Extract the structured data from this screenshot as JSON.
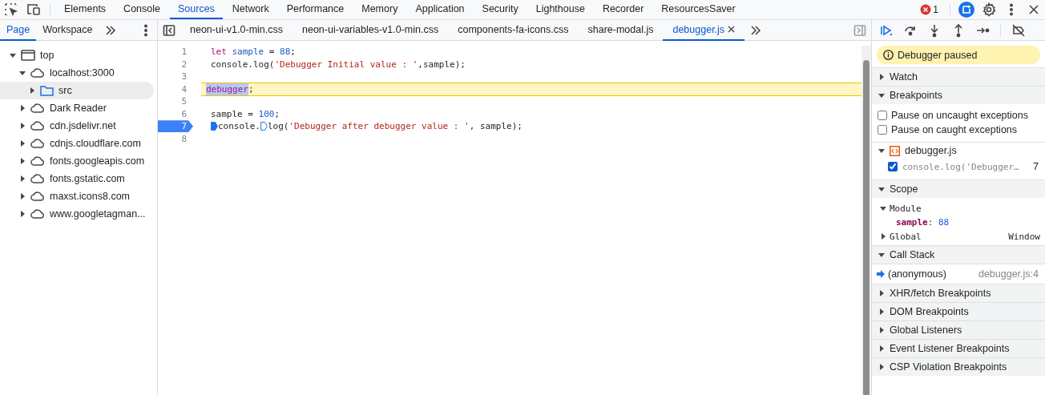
{
  "toolbar": {
    "error_count": "1"
  },
  "main_tabs": [
    {
      "label": "Elements",
      "selected": false
    },
    {
      "label": "Console",
      "selected": false
    },
    {
      "label": "Sources",
      "selected": true
    },
    {
      "label": "Network",
      "selected": false
    },
    {
      "label": "Performance",
      "selected": false
    },
    {
      "label": "Memory",
      "selected": false
    },
    {
      "label": "Application",
      "selected": false
    },
    {
      "label": "Security",
      "selected": false
    },
    {
      "label": "Lighthouse",
      "selected": false
    },
    {
      "label": "Recorder",
      "selected": false
    },
    {
      "label": "ResourcesSaver",
      "selected": false
    }
  ],
  "navigator": {
    "tabs": [
      {
        "label": "Page",
        "selected": true
      },
      {
        "label": "Workspace",
        "selected": false
      }
    ],
    "tree": [
      {
        "label": "top",
        "kind": "frame",
        "expanded": true,
        "selected": false,
        "children": [
          {
            "label": "localhost:3000",
            "kind": "origin",
            "expanded": true,
            "selected": false,
            "children": [
              {
                "label": "src",
                "kind": "folder",
                "expanded": false,
                "selected": true
              }
            ]
          },
          {
            "label": "Dark Reader",
            "kind": "origin",
            "expanded": false,
            "selected": false
          },
          {
            "label": "cdn.jsdelivr.net",
            "kind": "origin",
            "expanded": false,
            "selected": false
          },
          {
            "label": "cdnjs.cloudflare.com",
            "kind": "origin",
            "expanded": false,
            "selected": false
          },
          {
            "label": "fonts.googleapis.com",
            "kind": "origin",
            "expanded": false,
            "selected": false
          },
          {
            "label": "fonts.gstatic.com",
            "kind": "origin",
            "expanded": false,
            "selected": false
          },
          {
            "label": "maxst.icons8.com",
            "kind": "origin",
            "expanded": false,
            "selected": false
          },
          {
            "label": "www.googletagman...",
            "kind": "origin",
            "expanded": false,
            "selected": false
          }
        ]
      }
    ]
  },
  "editor": {
    "tabs": [
      {
        "label": "neon-ui-v1.0-min.css",
        "selected": false
      },
      {
        "label": "neon-ui-variables-v1.0-min.css",
        "selected": false
      },
      {
        "label": "components-fa-icons.css",
        "selected": false
      },
      {
        "label": "share-modal.js",
        "selected": false
      },
      {
        "label": "debugger.js",
        "selected": true
      }
    ],
    "lines": [
      {
        "number": "1",
        "paused": false,
        "breakpoint": false,
        "tokens": [
          {
            "text": "let",
            "kind": "keyword"
          },
          {
            "text": " sample",
            "kind": "definition"
          },
          {
            "text": " = ",
            "kind": "plain"
          },
          {
            "text": "88",
            "kind": "number"
          },
          {
            "text": ";",
            "kind": "plain"
          }
        ]
      },
      {
        "number": "2",
        "paused": false,
        "breakpoint": false,
        "tokens": [
          {
            "text": "console.log(",
            "kind": "plain"
          },
          {
            "text": "'Debugger Initial value : '",
            "kind": "string"
          },
          {
            "text": ",sample);",
            "kind": "plain"
          }
        ]
      },
      {
        "number": "3",
        "paused": false,
        "breakpoint": false
      },
      {
        "number": "4",
        "paused": true,
        "breakpoint": false,
        "tokens": [
          {
            "text": "debugger",
            "kind": "keyword",
            "highlighted": true
          },
          {
            "text": ";",
            "kind": "plain"
          }
        ]
      },
      {
        "number": "5",
        "paused": false,
        "breakpoint": false
      },
      {
        "number": "6",
        "paused": false,
        "breakpoint": false,
        "tokens": [
          {
            "text": "sample = ",
            "kind": "plain"
          },
          {
            "text": "100",
            "kind": "number"
          },
          {
            "text": ";",
            "kind": "plain"
          }
        ]
      },
      {
        "number": "7",
        "paused": false,
        "breakpoint": true,
        "tokens": [
          {
            "kind": "inline-breakpoint",
            "active": true
          },
          {
            "text": "console.",
            "kind": "plain"
          },
          {
            "kind": "inline-breakpoint",
            "active": false
          },
          {
            "text": "log(",
            "kind": "plain"
          },
          {
            "text": "'Debugger after debugger value : '",
            "kind": "string"
          },
          {
            "text": ", sample);",
            "kind": "plain"
          }
        ]
      },
      {
        "number": "8",
        "paused": false,
        "breakpoint": false
      }
    ]
  },
  "debugger": {
    "status": "Debugger paused",
    "sections": [
      {
        "title": "Watch",
        "expanded": false
      },
      {
        "title": "Breakpoints",
        "kind": "breakpoints",
        "expanded": true,
        "options": [
          {
            "label": "Pause on uncaught exceptions",
            "checked": false
          },
          {
            "label": "Pause on caught exceptions",
            "checked": false
          }
        ],
        "files": [
          {
            "name": "debugger.js",
            "expanded": true,
            "breakpoints": [
              {
                "code": "console.log('Debugger…",
                "line": "7",
                "checked": true
              }
            ]
          }
        ]
      },
      {
        "title": "Scope",
        "kind": "scope",
        "expanded": true,
        "scopes": [
          {
            "name": "Module",
            "expanded": true,
            "variables": [
              {
                "name": "sample",
                "separator": ":",
                "value": "88"
              }
            ]
          },
          {
            "name": "Global",
            "expanded": false,
            "value": "Window"
          }
        ]
      },
      {
        "title": "Call Stack",
        "kind": "callstack",
        "expanded": true,
        "frames": [
          {
            "name": "(anonymous)",
            "location": "debugger.js:4",
            "current": true
          }
        ]
      },
      {
        "title": "XHR/fetch Breakpoints",
        "expanded": false
      },
      {
        "title": "DOM Breakpoints",
        "expanded": false
      },
      {
        "title": "Global Listeners",
        "expanded": false
      },
      {
        "title": "Event Listener Breakpoints",
        "expanded": false
      },
      {
        "title": "CSP Violation Breakpoints",
        "expanded": false
      }
    ]
  }
}
